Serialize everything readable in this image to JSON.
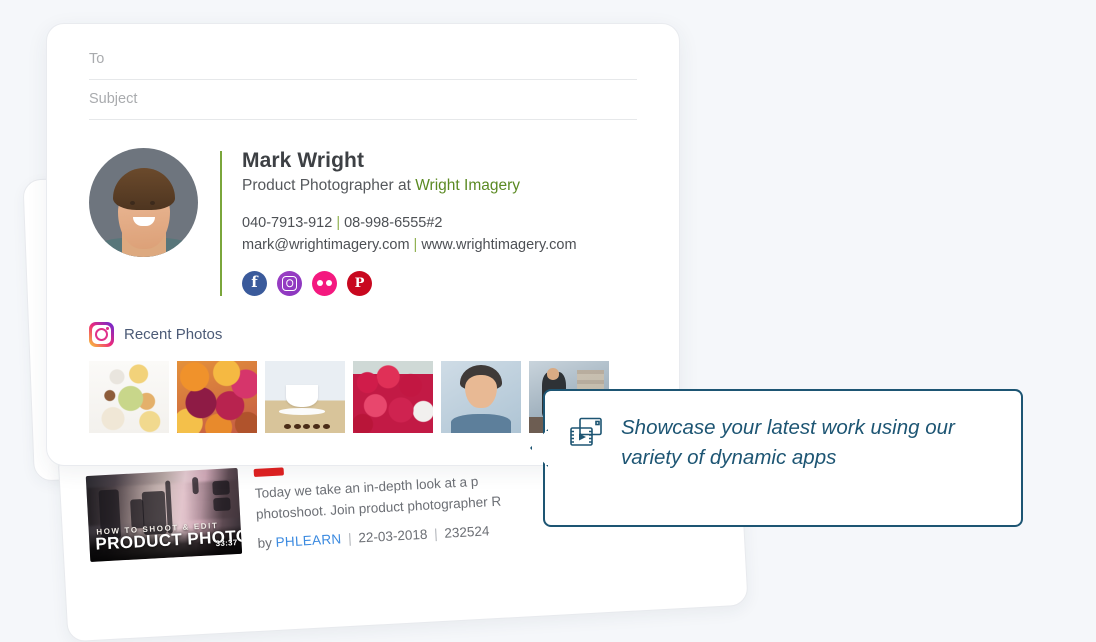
{
  "theme": {
    "background": "#f5f7fa",
    "card_background": "#ffffff",
    "accent_green": "#7aa63b",
    "company_green": "#5b8a23",
    "callout_border": "#1d5573",
    "callout_text": "#1d5573",
    "channel_link": "#3b8ae0"
  },
  "compose": {
    "to_placeholder": "To",
    "subject_placeholder": "Subject"
  },
  "signature": {
    "name": "Mark Wright",
    "role_prefix": "Product Photographer at ",
    "company": "Wright Imagery",
    "phone_primary": "040-7913-912",
    "phone_secondary": "08-998-6555#2",
    "email": "mark@wrightimagery.com",
    "website": "www.wrightimagery.com",
    "separator": "|",
    "social": [
      {
        "name": "facebook",
        "glyph": "f",
        "color": "#3a5a9b"
      },
      {
        "name": "instagram",
        "glyph": "",
        "color": "#9b3fc4"
      },
      {
        "name": "flickr",
        "glyph": "",
        "color": "#f4197f"
      },
      {
        "name": "pinterest",
        "glyph": "P",
        "color": "#c8081f"
      }
    ]
  },
  "recent_photos": {
    "label": "Recent Photos",
    "icon": "instagram-icon",
    "thumbnails": [
      {
        "alt": "food-flatlay"
      },
      {
        "alt": "citrus-and-pomegranate"
      },
      {
        "alt": "coffee-cup"
      },
      {
        "alt": "raspberries"
      },
      {
        "alt": "smiling-man"
      },
      {
        "alt": "barista-at-counter"
      }
    ]
  },
  "video_card": {
    "thumbnail_title_line1": "HOW TO SHOOT & EDIT",
    "thumbnail_title_line2": "PRODUCT PHOTOS",
    "duration": "33:37",
    "description_line1": "Today we take an in-depth look at a p",
    "description_line2": "photoshoot. Join product photographer R",
    "by_label": "by",
    "channel": "PHLEARN",
    "date": "22-03-2018",
    "views": "232524",
    "separator": "|"
  },
  "callout": {
    "icon": "video-app-icon",
    "line1": "Showcase your latest work using",
    "line2": "our variety of dynamic apps"
  }
}
